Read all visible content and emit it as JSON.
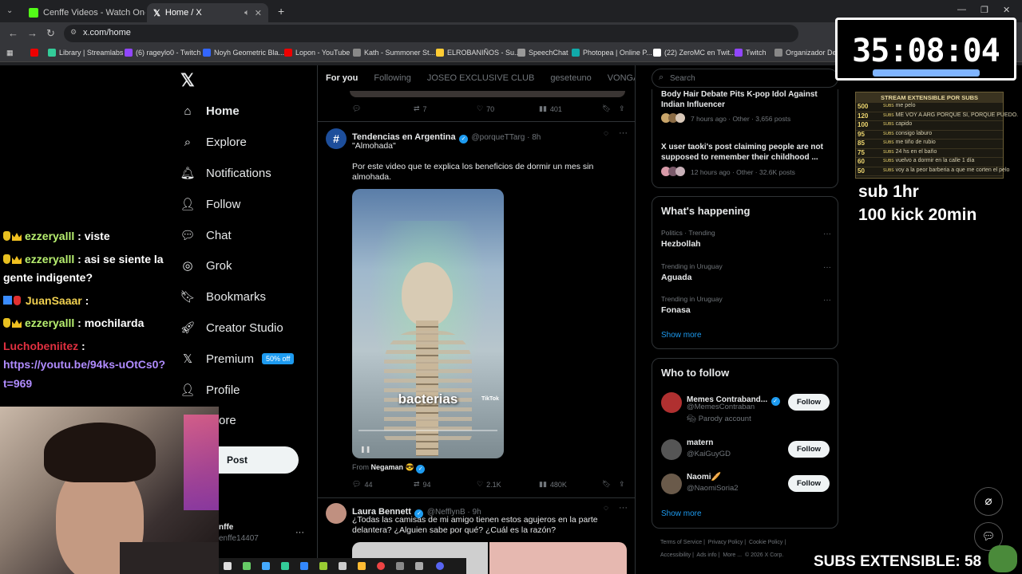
{
  "browser": {
    "tabs": [
      {
        "title": "Cenffe Videos - Watch On-Dem",
        "color": "#53fc18"
      },
      {
        "title": "Home / X",
        "color": "#ffffff"
      }
    ],
    "url": "x.com/home",
    "bookmarks": [
      "Library | Streamlabs",
      "(6) rageylo0 - Twitch",
      "Noyh Geometric Bla...",
      "Lopon - YouTube",
      "Kath - Summoner St...",
      "ELROBANIÑOS - Su...",
      "SpeechChat",
      "Photopea | Online P...",
      "(22) ZeroMC en Twit...",
      "Twitch",
      "Organizador De Z"
    ]
  },
  "x_nav": {
    "items": [
      {
        "label": "Home",
        "icon": "home-icon"
      },
      {
        "label": "Explore",
        "icon": "search-icon"
      },
      {
        "label": "Notifications",
        "icon": "bell-icon"
      },
      {
        "label": "Follow",
        "icon": "person-plus-icon"
      },
      {
        "label": "Chat",
        "icon": "chat-icon"
      },
      {
        "label": "Grok",
        "icon": "grok-icon"
      },
      {
        "label": "Bookmarks",
        "icon": "bookmark-icon"
      },
      {
        "label": "Creator Studio",
        "icon": "rocket-icon"
      },
      {
        "label": "Premium",
        "icon": "x-icon"
      },
      {
        "label": "Profile",
        "icon": "profile-icon"
      },
      {
        "label": "ore",
        "icon": ""
      }
    ],
    "premium_badge": "50% off",
    "post_label": "Post",
    "account_name": "nffe",
    "account_handle": "enffe14407"
  },
  "feed": {
    "tabs": [
      "For you",
      "Following",
      "JOSEO EXCLUSIVE CLUB",
      "geseteuno",
      "VONGANG"
    ],
    "prev_actions": {
      "replies": "",
      "reposts": "7",
      "likes": "70",
      "views": "401"
    },
    "post1": {
      "name": "Tendencias en Argentina",
      "handle": "@porqueTTarg · 8h",
      "line1": "\"Almohada\"",
      "line2": "Por este video que te explica los beneficios de dormir un mes sin almohada.",
      "caption": "bacterias",
      "tiktok": "TikTok",
      "from_label": "From",
      "from_user": "Negaman 😎",
      "replies": "44",
      "reposts": "94",
      "likes": "2.1K",
      "views": "480K"
    },
    "post2": {
      "name": "Laura Bennett",
      "handle": "@NefflynB · 9h",
      "text": "¿Todas las camisas de mi amigo tienen estos agujeros en la parte delantera? ¿Alguien sabe por qué? ¿Cuál es la razón?"
    }
  },
  "right": {
    "search_placeholder": "Search",
    "news": [
      {
        "title": "Body Hair Debate Pits K-pop Idol Against Indian Influencer",
        "meta": "7 hours ago · Other · 3,656 posts"
      },
      {
        "title": "X user taoki's post claiming people are not supposed to remember their childhood ...",
        "meta": "12 hours ago · Other · 32.6K posts"
      }
    ],
    "happening_title": "What's happening",
    "trends": [
      {
        "context": "Politics · Trending",
        "name": "Hezbollah"
      },
      {
        "context": "Trending in Uruguay",
        "name": "Aguada"
      },
      {
        "context": "Trending in Uruguay",
        "name": "Fonasa"
      }
    ],
    "show_more": "Show more",
    "wtf_title": "Who to follow",
    "follows": [
      {
        "name": "Memes Contraband...",
        "handle": "@MemesContraban",
        "extra": "Parody account",
        "avatar_color": "#b03030"
      },
      {
        "name": "matern",
        "handle": "@KaiGuyGD",
        "extra": "",
        "avatar_color": "#555555"
      },
      {
        "name": "Naomi🥖",
        "handle": "@NaomiSoria2",
        "extra": "",
        "avatar_color": "#6a5a4a"
      }
    ],
    "follow_label": "Follow",
    "footer": [
      "Terms of Service",
      "Privacy Policy",
      "Cookie Policy",
      "Accessibility",
      "Ads info",
      "More ...",
      "© 2026 X Corp."
    ]
  },
  "stream": {
    "chat": [
      {
        "user": "ezzeryalll",
        "msg": ": viste"
      },
      {
        "user": "ezzeryalll",
        "msg": ": asi se siente la"
      },
      {
        "user": "",
        "msg": "gente indigente?"
      },
      {
        "user": "JuanSaaar",
        "msg": ":"
      },
      {
        "user": "ezzeryalll",
        "msg": ": mochilarda"
      },
      {
        "user": "Luchobeniitez",
        "msg": ":"
      },
      {
        "user": "",
        "msg": "https://youtu.be/94ks-uOtCs0?"
      },
      {
        "user": "",
        "msg": "t=969"
      }
    ],
    "timer": "35:08:04",
    "subs_table_title": "STREAM EXTENSIBLE POR SUBS",
    "subs_rows": [
      {
        "count": "500",
        "desc": "me pelo"
      },
      {
        "count": "120",
        "desc": "ME VOY A ARG PORQUE SI, PORQUE PUEDO."
      },
      {
        "count": "100",
        "desc": "capido"
      },
      {
        "count": "95",
        "desc": "consigo laburo"
      },
      {
        "count": "85",
        "desc": "me tiño de rubio"
      },
      {
        "count": "75",
        "desc": "24 hs en el baño"
      },
      {
        "count": "60",
        "desc": "vuelvo a dormir en la calle 1 día"
      },
      {
        "count": "50",
        "desc": "voy a la peor barberia a que me corten el pelo"
      }
    ],
    "subs_unit": "SUBS",
    "sub_line1": "sub 1hr",
    "sub_line2": "100 kick 20min",
    "subs_extensible": "SUBS EXTENSIBLE: 58"
  }
}
